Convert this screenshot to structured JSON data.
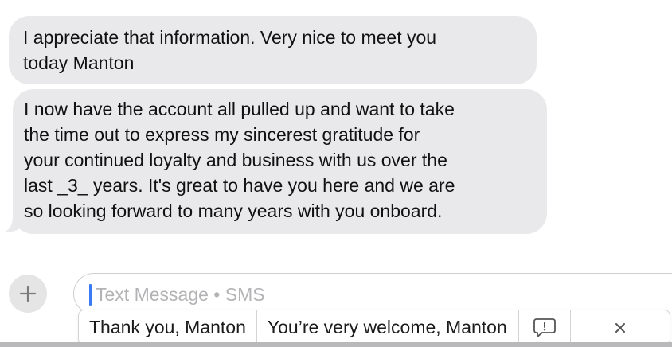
{
  "messages": [
    {
      "text": "I appreciate that information. Very nice to meet you\ntoday Manton"
    },
    {
      "text": "I now have the account all pulled up and want to take\nthe time out to express my sincerest gratitude for\nyour continued loyalty and business with us over the\nlast _3_ years. It's great to have you here and we are\nso looking forward to many years with you onboard."
    }
  ],
  "composer": {
    "plus_icon": "plus-icon",
    "placeholder": "Text Message • SMS",
    "value": ""
  },
  "suggestions": {
    "items": [
      {
        "label": "Thank you, Manton"
      },
      {
        "label": "You’re very welcome, Manton"
      }
    ],
    "feedback_icon": "feedback-bubble-icon",
    "close_icon": "close-icon"
  },
  "colors": {
    "bubble_gray": "#e9e9eb",
    "caret_blue": "#3a7bf5",
    "placeholder_gray": "#b3b3b6"
  }
}
